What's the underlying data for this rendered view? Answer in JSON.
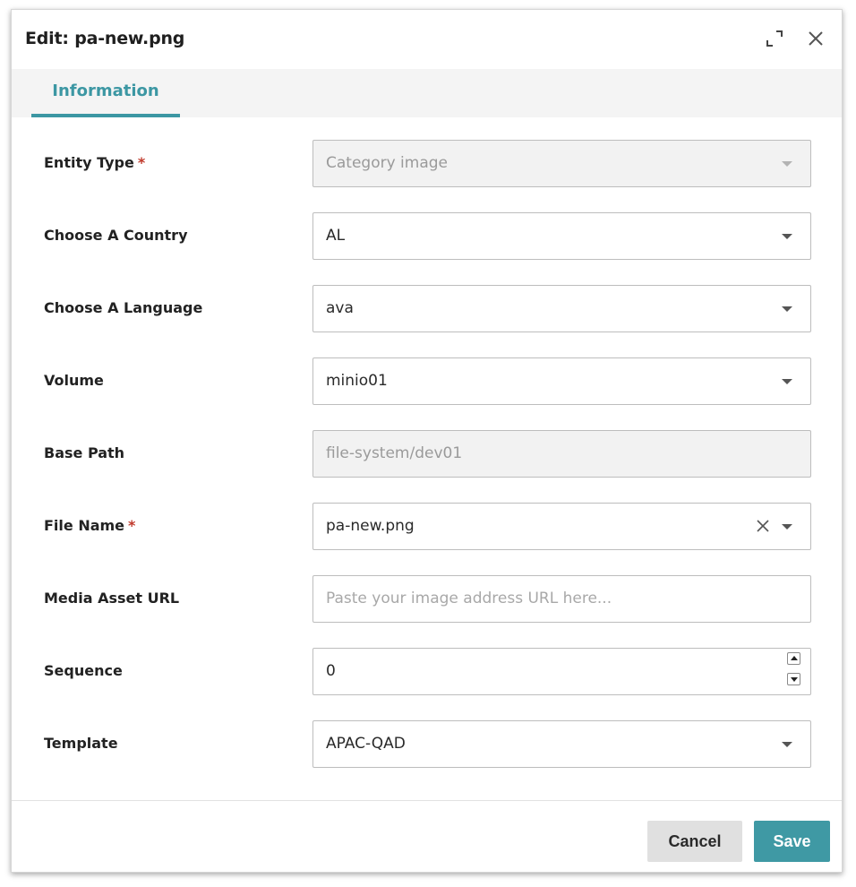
{
  "dialog": {
    "title": "Edit: pa-new.png",
    "expand_icon": "expand-icon",
    "close_icon": "close-icon"
  },
  "tabs": [
    {
      "label": "Information",
      "active": true
    }
  ],
  "form": {
    "entity_type": {
      "label": "Entity Type",
      "required": "*",
      "value": "Category image",
      "disabled": true
    },
    "country": {
      "label": "Choose A Country",
      "value": "AL"
    },
    "language": {
      "label": "Choose A Language",
      "value": "ava"
    },
    "volume": {
      "label": "Volume",
      "value": "minio01"
    },
    "base_path": {
      "label": "Base Path",
      "value": "file-system/dev01",
      "disabled": true
    },
    "file_name": {
      "label": "File Name",
      "required": "*",
      "value": "pa-new.png"
    },
    "media_asset_url": {
      "label": "Media Asset URL",
      "value": "",
      "placeholder": "Paste your image address URL here..."
    },
    "sequence": {
      "label": "Sequence",
      "value": "0"
    },
    "template": {
      "label": "Template",
      "value": "APAC-QAD"
    }
  },
  "footer": {
    "cancel_label": "Cancel",
    "save_label": "Save"
  },
  "colors": {
    "accent": "#3c97a3",
    "required": "#c0392b",
    "cancel_bg": "#e0e0e0",
    "save_bg": "#3f99a4"
  }
}
